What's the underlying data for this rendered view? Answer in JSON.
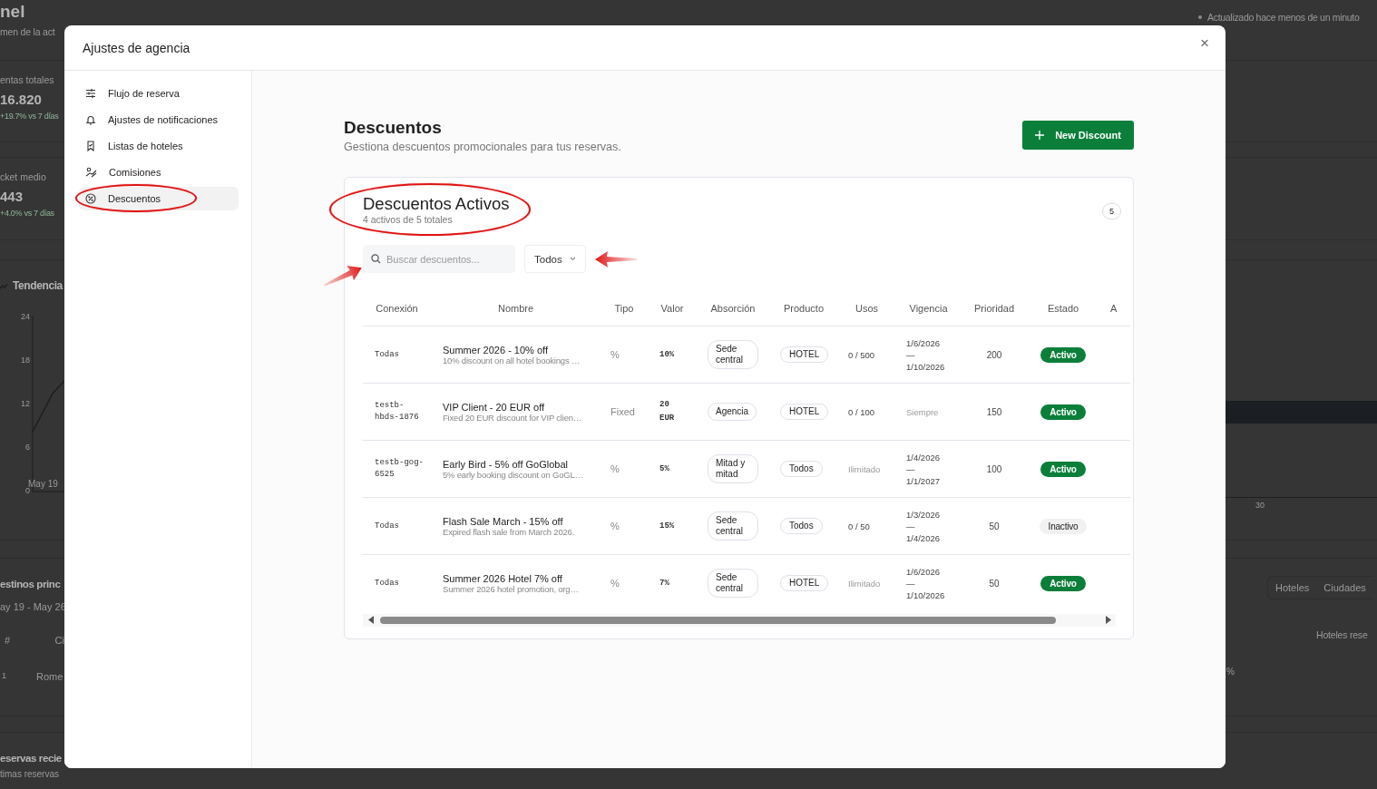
{
  "background": {
    "header": {
      "title": "nel",
      "subtitle": "men de la act",
      "updated": "Actualizado hace menos de un minuto"
    },
    "stats": [
      {
        "label": "entas totales",
        "value": "16.820",
        "change": "+19.7% vs 7 días"
      },
      {
        "label": "cket medio",
        "value": "443",
        "change": "+4.0% vs 7 días"
      }
    ],
    "trend": {
      "title": "Tendencia",
      "y_ticks": [
        "24",
        "18",
        "12",
        "6",
        "0"
      ],
      "x_labels": [
        "May 19",
        "30"
      ]
    },
    "destinations": {
      "title": "estinos princ",
      "subtitle": "ay 19 - May 26",
      "tabs": [
        "Hoteles",
        "Ciudades"
      ],
      "columns": [
        "#",
        "Ci",
        "Hoteles rese"
      ],
      "row": [
        "1",
        "Rome",
        "%"
      ]
    },
    "recent": {
      "title": "eservas recie",
      "subtitle": "timas reservas"
    }
  },
  "modal": {
    "title": "Ajustes de agencia",
    "close": "×",
    "sidebar": [
      {
        "label": "Flujo de reserva",
        "selected": false,
        "circled": false
      },
      {
        "label": "Ajustes de notificaciones",
        "selected": false,
        "circled": false
      },
      {
        "label": "Listas de hoteles",
        "selected": false,
        "circled": false
      },
      {
        "label": "Comisiones",
        "selected": false,
        "circled": false
      },
      {
        "label": "Descuentos",
        "selected": true,
        "circled": true
      }
    ],
    "page": {
      "title": "Descuentos",
      "subtitle": "Gestiona descuentos promocionales para tus reservas.",
      "new_button": "New Discount"
    },
    "card": {
      "title": "Descuentos Activos",
      "title_circled": true,
      "subtitle": "4 activos de 5 totales",
      "count": "5",
      "search": {
        "placeholder": "Buscar descuentos...",
        "arrow": true
      },
      "filter": {
        "value": "Todos",
        "arrow": true
      },
      "columns": [
        "Conexión",
        "Nombre",
        "Tipo",
        "Valor",
        "Absorción",
        "Producto",
        "Usos",
        "Vigencia",
        "Prioridad",
        "Estado",
        "A"
      ],
      "rows": [
        {
          "conexion": "Todas",
          "name": "Summer 2026 - 10% off",
          "description": "10% discount on all hotel bookings …",
          "tipo": "%",
          "valor": "10%",
          "absorcion": "Sede central",
          "producto": "HOTEL",
          "usos": "0 / 500",
          "usos_muted": false,
          "vigencia": [
            "1/6/2026",
            "—",
            "1/10/2026"
          ],
          "vigencia_muted": false,
          "prioridad": "200",
          "estado": {
            "label": "Activo",
            "active": true
          }
        },
        {
          "conexion": "testb-hbds-1876",
          "name": "VIP Client - 20 EUR off",
          "description": "Fixed 20 EUR discount for VIP clien…",
          "tipo": "Fixed",
          "valor": "20 EUR",
          "absorcion": "Agencia",
          "producto": "HOTEL",
          "usos": "0 / 100",
          "usos_muted": false,
          "vigencia": [
            "Siempre"
          ],
          "vigencia_muted": true,
          "prioridad": "150",
          "estado": {
            "label": "Activo",
            "active": true
          }
        },
        {
          "conexion": "testb-gog-6525",
          "name": "Early Bird - 5% off GoGlobal",
          "description": "5% early booking discount on GoGL…",
          "tipo": "%",
          "valor": "5%",
          "absorcion": "Mitad y mitad",
          "producto": "Todos",
          "usos": "Ilimitado",
          "usos_muted": true,
          "vigencia": [
            "1/4/2026",
            "—",
            "1/1/2027"
          ],
          "vigencia_muted": false,
          "prioridad": "100",
          "estado": {
            "label": "Activo",
            "active": true
          }
        },
        {
          "conexion": "Todas",
          "name": "Flash Sale March - 15% off",
          "description": "Expired flash sale from March 2026.",
          "tipo": "%",
          "valor": "15%",
          "absorcion": "Sede central",
          "producto": "Todos",
          "usos": "0 / 50",
          "usos_muted": false,
          "vigencia": [
            "1/3/2026",
            "—",
            "1/4/2026"
          ],
          "vigencia_muted": false,
          "prioridad": "50",
          "estado": {
            "label": "Inactivo",
            "active": false
          }
        },
        {
          "conexion": "Todas",
          "name": "Summer 2026 Hotel 7% off",
          "description": "Summer 2026 hotel promotion, org…",
          "tipo": "%",
          "valor": "7%",
          "absorcion": "Sede central",
          "producto": "HOTEL",
          "usos": "Ilimitado",
          "usos_muted": true,
          "vigencia": [
            "1/6/2026",
            "—",
            "1/10/2026"
          ],
          "vigencia_muted": false,
          "prioridad": "50",
          "estado": {
            "label": "Activo",
            "active": true
          }
        }
      ]
    }
  }
}
